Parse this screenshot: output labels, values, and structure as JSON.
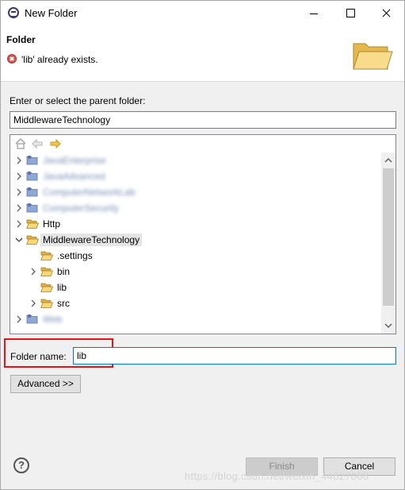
{
  "window": {
    "title": "New Folder"
  },
  "header": {
    "title": "Folder",
    "message": "'lib' already exists."
  },
  "parent": {
    "label": "Enter or select the parent folder:",
    "value": "MiddlewareTechnology"
  },
  "tree": {
    "rows": [
      {
        "label": "JavaEnterprise",
        "blurred": true,
        "expander": "collapsed"
      },
      {
        "label": "JavaAdvanced",
        "blurred": true,
        "expander": "collapsed"
      },
      {
        "label": "ComputerNetworkLab",
        "blurred": true,
        "expander": "collapsed"
      },
      {
        "label": "ComputerSecurity",
        "blurred": true,
        "expander": "collapsed"
      },
      {
        "label": "Http",
        "blurred": false,
        "expander": "collapsed"
      },
      {
        "label": "MiddlewareTechnology",
        "blurred": false,
        "expander": "expanded",
        "selected": true
      },
      {
        "label": ".settings",
        "blurred": false,
        "expander": "none",
        "child": true
      },
      {
        "label": "bin",
        "blurred": false,
        "expander": "collapsed",
        "child": true
      },
      {
        "label": "lib",
        "blurred": false,
        "expander": "none",
        "child": true
      },
      {
        "label": "src",
        "blurred": false,
        "expander": "collapsed",
        "child": true
      },
      {
        "label": "Web",
        "blurred": true,
        "expander": "collapsed"
      }
    ]
  },
  "folder_name": {
    "label": "Folder name:",
    "value": "lib"
  },
  "buttons": {
    "advanced": "Advanced >>",
    "finish": "Finish",
    "cancel": "Cancel",
    "help": "?"
  },
  "watermark": "https://blog.csdn.net/weixin_44627068",
  "colors": {
    "highlight": "#e0161d",
    "folder": "#f2c14e",
    "error": "#d9534f"
  }
}
